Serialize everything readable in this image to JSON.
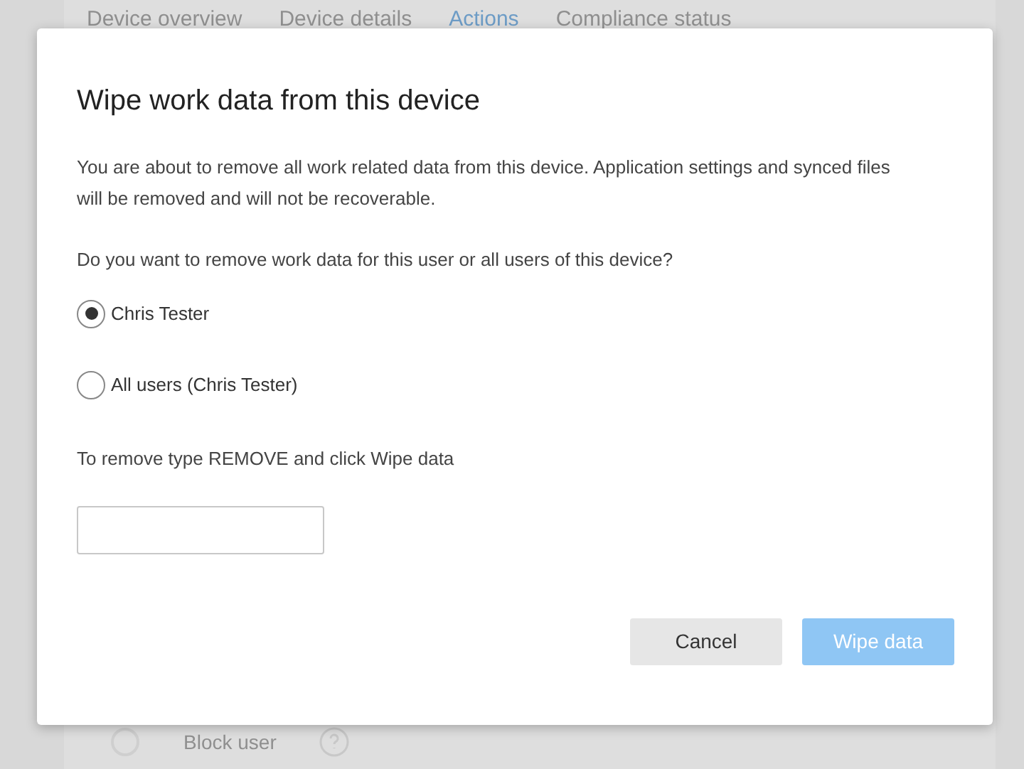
{
  "background": {
    "tabs": [
      {
        "label": "Device overview",
        "selected": false
      },
      {
        "label": "Device details",
        "selected": false
      },
      {
        "label": "Actions",
        "selected": true
      },
      {
        "label": "Compliance status",
        "selected": false
      }
    ],
    "action": {
      "label": "Block user"
    }
  },
  "dialog": {
    "title": "Wipe work data from this device",
    "message": "You are about to remove all work related data from this device. Application settings and synced files will be removed and will not be recoverable.",
    "question": "Do you want to remove work data for this user or all users of this device?",
    "options": [
      {
        "label": "Chris Tester",
        "selected": true
      },
      {
        "label": "All users (Chris Tester)",
        "selected": false
      }
    ],
    "confirm_label": "To remove type REMOVE and click Wipe data",
    "buttons": [
      {
        "label": "Cancel",
        "kind": "secondary",
        "disabled": false
      },
      {
        "label": "Wipe data",
        "kind": "primary",
        "disabled": true
      }
    ]
  }
}
